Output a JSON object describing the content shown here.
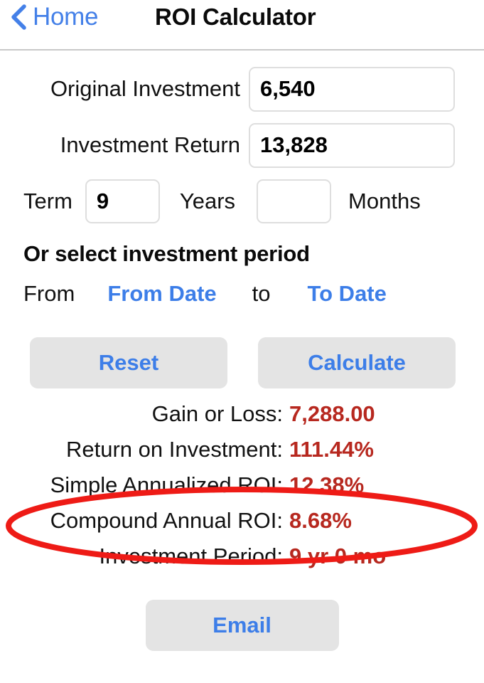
{
  "header": {
    "back_label": "Home",
    "back_icon": "chevron-left-icon",
    "title": "ROI Calculator"
  },
  "form": {
    "original_investment": {
      "label": "Original Investment",
      "value": "6,540",
      "placeholder": ""
    },
    "investment_return": {
      "label": "Investment Return",
      "value": "13,828",
      "placeholder": ""
    },
    "term": {
      "label": "Term",
      "years_value": "9",
      "years_label": "Years",
      "months_value": "",
      "months_label": "Months",
      "years_placeholder": "",
      "months_placeholder": ""
    },
    "period_heading": "Or select investment period",
    "date_range": {
      "from_label": "From",
      "from_date_link": "From Date",
      "to_label": "to",
      "to_date_link": "To Date"
    }
  },
  "actions": {
    "reset_label": "Reset",
    "calculate_label": "Calculate",
    "email_label": "Email"
  },
  "results": [
    {
      "label": "Gain or Loss:",
      "value": "7,288.00"
    },
    {
      "label": "Return on Investment:",
      "value": "111.44%"
    },
    {
      "label": "Simple Annualized ROI:",
      "value": "12.38%"
    },
    {
      "label": "Compound Annual ROI:",
      "value": "8.68%"
    },
    {
      "label": "Investment Period:",
      "value": "9 yr 0 mo"
    }
  ],
  "annotation": {
    "type": "ellipse-highlight",
    "color": "#ee1b16",
    "highlights": [
      "Simple Annualized ROI: 12.38%",
      "Compound Annual ROI: 8.68%"
    ]
  },
  "colors": {
    "accent_blue": "#3d7ee8",
    "result_red": "#b7281f",
    "button_gray": "#e4e4e4",
    "annotation_red": "#ee1b16"
  }
}
